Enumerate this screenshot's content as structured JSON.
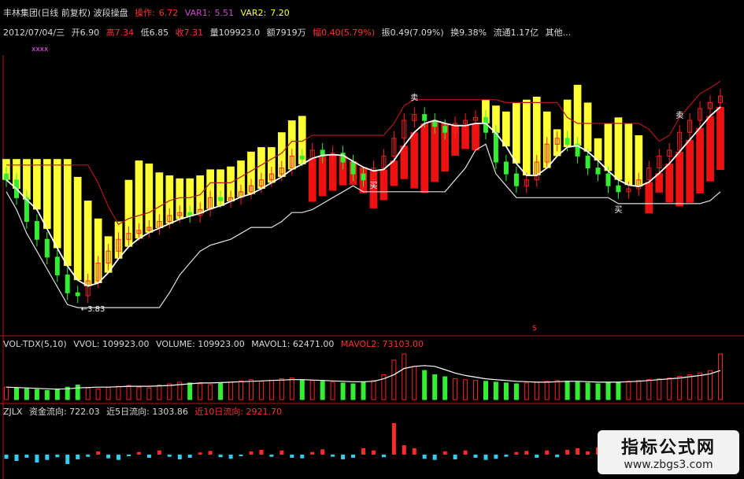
{
  "header": {
    "stock": "丰林集团(日线 前复权) 波段操盘",
    "op_label": "操作:",
    "op_value": "6.72",
    "var1_label": "VAR1:",
    "var1_value": "5.51",
    "var2_label": "VAR2:",
    "var2_value": "7.20"
  },
  "info": {
    "date": "2012/07/04/三",
    "open": "开6.90",
    "high": "高7.34",
    "low": "低6.85",
    "close": "收7.31",
    "volume": "量109923.0",
    "amount": "额7919万",
    "change": "幅0.40(5.79%)",
    "amplitude": "振0.49(7.09%)",
    "turnover": "换9.38%",
    "float": "流通1.17亿",
    "other": "其他..."
  },
  "top_marks": "xxxx",
  "volume_panel": {
    "name": "VOL-TDX(5,10)",
    "vvol": "VVOL: 109923.00",
    "volume": "VOLUME: 109923.00",
    "mavol1": "MAVOL1: 62471.00",
    "mavol2": "MAVOL2: 73103.00"
  },
  "flow_panel": {
    "name": "ZJLX",
    "flow": "资金流向: 722.03",
    "flow5": "近5日流向: 1303.86",
    "flow10": "近10日流向: 2921.70"
  },
  "annotations": {
    "low_arrow": "←3.83",
    "sell_label": "卖",
    "buy_label": "买",
    "s_label": "S"
  },
  "watermark": {
    "title": "指标公式网",
    "url": "www.zbgs3.com"
  },
  "colors": {
    "bg": "#000000",
    "up": "#ff2020",
    "down": "#33ee33",
    "band_bear": "#ffff33",
    "band_bull": "#ee1111",
    "ma": "#ffffff",
    "resistance": "#b01818",
    "support": "#e0e0e0",
    "flow_up": "#ff2a2a",
    "flow_down": "#33ccee",
    "divider": "#b01818"
  },
  "chart_data": [
    {
      "type": "candlestick",
      "title": "丰林集团(日线 前复权) 波段操盘",
      "ylim": [
        3.5,
        8.0
      ],
      "closes": [
        5.9,
        5.6,
        5.2,
        4.9,
        4.6,
        4.3,
        4.0,
        3.95,
        4.2,
        4.5,
        4.7,
        4.9,
        5.0,
        5.05,
        5.1,
        5.2,
        5.3,
        5.35,
        5.3,
        5.4,
        5.6,
        5.55,
        5.6,
        5.7,
        5.8,
        5.9,
        6.0,
        6.1,
        6.3,
        6.25,
        6.4,
        6.3,
        6.35,
        6.2,
        6.0,
        5.9,
        6.1,
        6.3,
        6.6,
        6.9,
        7.0,
        6.9,
        6.8,
        6.7,
        6.85,
        6.9,
        6.95,
        6.7,
        6.2,
        6.0,
        5.8,
        5.9,
        6.2,
        6.5,
        6.6,
        6.5,
        6.3,
        6.1,
        6.0,
        5.8,
        5.7,
        5.75,
        5.9,
        6.1,
        6.3,
        6.4,
        6.7,
        6.9,
        7.1,
        7.2,
        7.31
      ],
      "min_price_label": 3.83,
      "band_turns_bull_index": 30,
      "band_turns_bear_index": 47,
      "band_turns_bull_again_index": 63
    },
    {
      "type": "bar",
      "title": "VOL-TDX(5,10)",
      "series": [
        {
          "name": "VOLUME",
          "values": [
            30,
            28,
            26,
            24,
            22,
            25,
            30,
            35,
            28,
            26,
            30,
            32,
            34,
            30,
            28,
            35,
            38,
            42,
            40,
            38,
            36,
            40,
            42,
            45,
            48,
            44,
            46,
            50,
            52,
            48,
            46,
            44,
            42,
            40,
            38,
            42,
            46,
            60,
            95,
            110,
            80,
            70,
            60,
            55,
            50,
            48,
            46,
            44,
            42,
            40,
            38,
            40,
            42,
            44,
            46,
            44,
            42,
            40,
            38,
            40,
            42,
            44,
            46,
            48,
            50,
            52,
            56,
            60,
            64,
            70,
            110
          ]
        },
        {
          "name": "MAVOL1",
          "values": [
            30,
            29,
            28,
            27,
            26,
            25,
            26,
            28,
            29,
            30,
            30,
            31,
            32,
            32,
            32,
            33,
            34,
            36,
            38,
            40,
            40,
            41,
            42,
            43,
            44,
            45,
            46,
            47,
            48,
            48,
            47,
            46,
            45,
            44,
            43,
            43,
            44,
            50,
            60,
            75,
            80,
            82,
            80,
            72,
            64,
            58,
            54,
            50,
            48,
            46,
            44,
            43,
            42,
            42,
            43,
            44,
            44,
            43,
            42,
            42,
            42,
            43,
            44,
            46,
            48,
            50,
            52,
            55,
            58,
            62,
            70
          ]
        }
      ]
    },
    {
      "type": "bar",
      "title": "ZJLX",
      "series": [
        {
          "name": "资金流向",
          "values": [
            -8,
            -12,
            -6,
            -15,
            -10,
            -5,
            -18,
            -9,
            -4,
            6,
            -7,
            -10,
            -3,
            5,
            -6,
            8,
            -4,
            -9,
            -6,
            4,
            7,
            -5,
            -8,
            -3,
            6,
            9,
            -4,
            8,
            -6,
            -7,
            5,
            10,
            -4,
            -9,
            -6,
            12,
            8,
            -5,
            60,
            18,
            12,
            -8,
            -10,
            6,
            -9,
            8,
            -6,
            -10,
            -8,
            -4,
            5,
            7,
            -6,
            8,
            -5,
            9,
            12,
            6,
            14,
            10,
            -4,
            -6,
            5,
            -8,
            6,
            -5,
            8,
            10,
            9,
            12,
            14
          ]
        }
      ]
    }
  ]
}
